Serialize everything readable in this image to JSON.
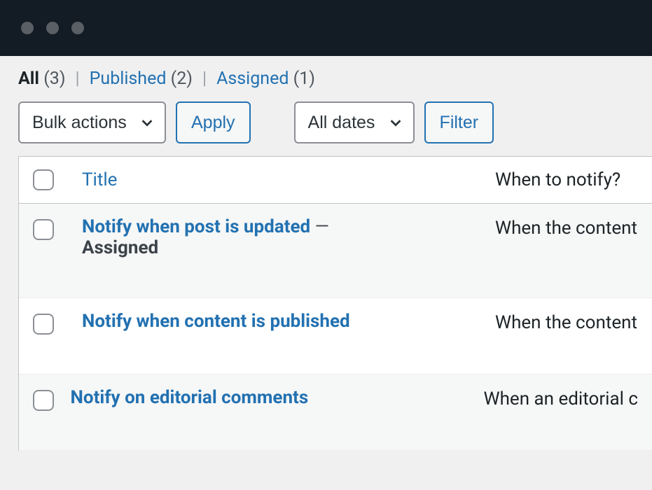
{
  "filters": {
    "all": {
      "label": "All",
      "count": "(3)"
    },
    "published": {
      "label": "Published",
      "count": "(2)"
    },
    "assigned": {
      "label": "Assigned",
      "count": "(1)"
    }
  },
  "actions": {
    "bulk_select": "Bulk actions",
    "apply": "Apply",
    "date_select": "All dates",
    "filter": "Filter"
  },
  "columns": {
    "title": "Title",
    "when": "When to notify?"
  },
  "rows": [
    {
      "title": "Notify when post is updated",
      "status": "Assigned",
      "when": "When the content"
    },
    {
      "title": "Notify when content is published",
      "status": "",
      "when": "When the content"
    },
    {
      "title": "Notify on editorial comments",
      "status": "",
      "when": "When an editorial c"
    }
  ]
}
